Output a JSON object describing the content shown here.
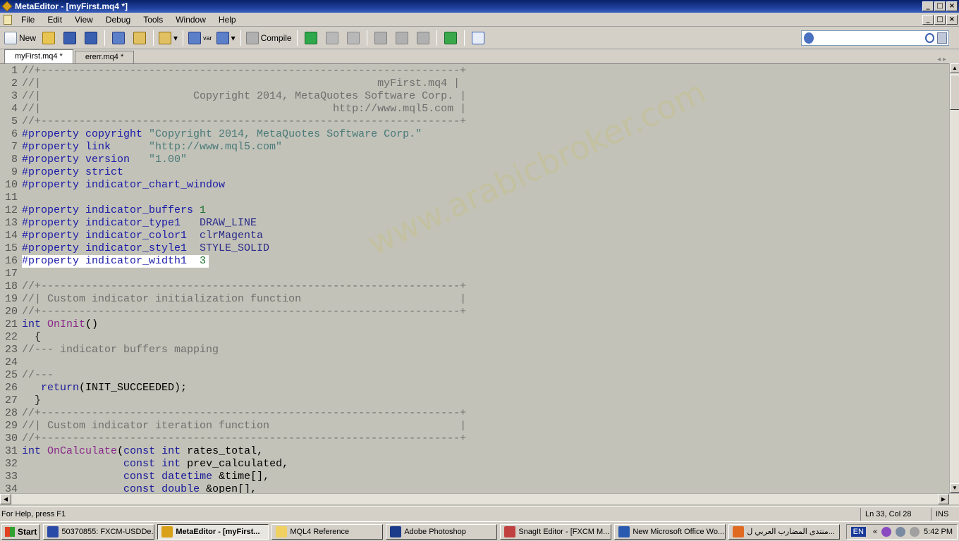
{
  "window": {
    "title": "MetaEditor - [myFirst.mq4 *]"
  },
  "menu": [
    "File",
    "Edit",
    "View",
    "Debug",
    "Tools",
    "Window",
    "Help"
  ],
  "toolbar": {
    "new_label": "New",
    "compile_label": "Compile",
    "var_label": "var"
  },
  "tabs": [
    {
      "label": "myFirst.mq4 *"
    },
    {
      "label": "ererr.mq4 *"
    }
  ],
  "code": [
    {
      "n": "1",
      "t": "//+------------------------------------------------------------------+",
      "k": "comment"
    },
    {
      "n": "2",
      "t": "//|                                                     myFirst.mq4 |",
      "k": "comment"
    },
    {
      "n": "3",
      "t": "//|                        Copyright 2014, MetaQuotes Software Corp. |",
      "k": "comment"
    },
    {
      "n": "4",
      "t": "//|                                              http://www.mql5.com |",
      "k": "comment"
    },
    {
      "n": "5",
      "t": "//+------------------------------------------------------------------+",
      "k": "comment"
    },
    {
      "n": "6",
      "t": "#property copyright \"Copyright 2014, MetaQuotes Software Corp.\"",
      "k": "prop",
      "s": "\"Copyright 2014, MetaQuotes Software Corp.\""
    },
    {
      "n": "7",
      "t": "#property link      \"http://www.mql5.com\"",
      "k": "prop",
      "s": "\"http://www.mql5.com\""
    },
    {
      "n": "8",
      "t": "#property version   \"1.00\"",
      "k": "prop",
      "s": "\"1.00\""
    },
    {
      "n": "9",
      "t": "#property strict",
      "k": "dir"
    },
    {
      "n": "10",
      "t": "#property indicator_chart_window",
      "k": "dir"
    },
    {
      "n": "11",
      "t": "",
      "k": "plain"
    },
    {
      "n": "12",
      "t": "#property indicator_buffers 1",
      "k": "dir"
    },
    {
      "n": "13",
      "t": "#property indicator_type1   DRAW_LINE",
      "k": "dir"
    },
    {
      "n": "14",
      "t": "#property indicator_color1  clrMagenta",
      "k": "dir"
    },
    {
      "n": "15",
      "t": "#property indicator_style1  STYLE_SOLID",
      "k": "dir"
    },
    {
      "n": "16",
      "t": "#property indicator_width1  3",
      "k": "dir",
      "hl": true
    },
    {
      "n": "17",
      "t": "",
      "k": "plain"
    },
    {
      "n": "18",
      "t": "//+------------------------------------------------------------------+",
      "k": "comment"
    },
    {
      "n": "19",
      "t": "//| Custom indicator initialization function                         |",
      "k": "comment"
    },
    {
      "n": "20",
      "t": "//+------------------------------------------------------------------+",
      "k": "comment"
    },
    {
      "n": "21",
      "t": "int OnInit()",
      "k": "func"
    },
    {
      "n": "22",
      "t": "  {",
      "k": "plain"
    },
    {
      "n": "23",
      "t": "//--- indicator buffers mapping",
      "k": "comment"
    },
    {
      "n": "24",
      "t": "",
      "k": "plain"
    },
    {
      "n": "25",
      "t": "//---",
      "k": "comment"
    },
    {
      "n": "26",
      "t": "   return(INIT_SUCCEEDED);",
      "k": "kw"
    },
    {
      "n": "27",
      "t": "  }",
      "k": "plain"
    },
    {
      "n": "28",
      "t": "//+------------------------------------------------------------------+",
      "k": "comment"
    },
    {
      "n": "29",
      "t": "//| Custom indicator iteration function                              |",
      "k": "comment"
    },
    {
      "n": "30",
      "t": "//+------------------------------------------------------------------+",
      "k": "comment"
    },
    {
      "n": "31",
      "t": "int OnCalculate(const int rates_total,",
      "k": "func"
    },
    {
      "n": "32",
      "t": "                const int prev_calculated,",
      "k": "kw"
    },
    {
      "n": "33",
      "t": "                const datetime &time[],",
      "k": "kw"
    },
    {
      "n": "34",
      "t": "                const double &open[],",
      "k": "kw"
    }
  ],
  "status": {
    "help": "For Help, press F1",
    "position": "Ln 33, Col 28",
    "mode": "INS"
  },
  "taskbar": {
    "start": "Start",
    "tasks": [
      {
        "label": "50370855: FXCM-USDDe...",
        "color": "#2a4aa8"
      },
      {
        "label": "MetaEditor - [myFirst...",
        "color": "#d9a11a",
        "active": true
      },
      {
        "label": "MQL4 Reference",
        "color": "#f0d060"
      },
      {
        "label": "Adobe Photoshop",
        "color": "#1a3a8a"
      },
      {
        "label": "SnagIt Editor - [FXCM M...",
        "color": "#c04040"
      },
      {
        "label": "New Microsoft Office Wo...",
        "color": "#2a5ab0"
      },
      {
        "label": "منتدى المضارب العربي ل...",
        "color": "#e06a20"
      }
    ],
    "lang": "EN",
    "clock": "5:42 PM"
  },
  "watermark": "www.arabicbroker.com",
  "colors": {
    "title_bar": "#0a246a",
    "editor_bg": "#c2c2b8",
    "highlight": "#ffffff"
  }
}
